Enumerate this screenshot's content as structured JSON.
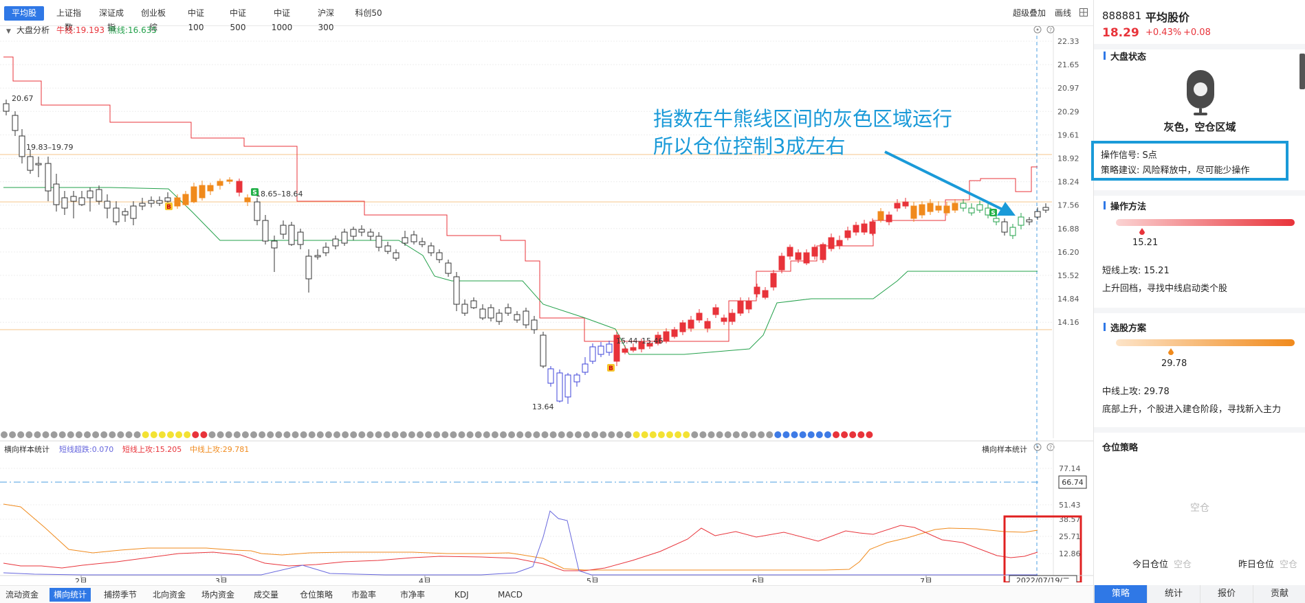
{
  "top_tabs": [
    "平均股价",
    "上证指数",
    "深证成指",
    "创业板综",
    "中证100",
    "中证500",
    "中证1000",
    "沪深300",
    "科创50"
  ],
  "active_top_tab": 0,
  "top_tools": {
    "overlay": "超级叠加",
    "draw": "画线"
  },
  "main_legend": {
    "toggle": "大盘分析",
    "bull_label": "牛线:19.193",
    "bear_label": "熊线:16.635"
  },
  "main_price_ticks": [
    "22.33",
    "21.65",
    "20.97",
    "20.29",
    "19.61",
    "18.92",
    "18.24",
    "17.56",
    "16.88",
    "16.20",
    "15.52",
    "14.84",
    "14.16"
  ],
  "main_annotations": {
    "a1": "20.67",
    "a2": "19.83–19.79",
    "a3": "18.65–18.64",
    "a4": "15.44–15.46",
    "a5": "13.64"
  },
  "callout": {
    "line1": "指数在牛熊线区间的灰色区域运行",
    "line2": "所以仓位控制3成左右"
  },
  "sub_legend": {
    "title": "横向样本统计",
    "short_drop": "短线超跌:0.070",
    "short_up": "短线上攻:15.205",
    "mid_up": "中线上攻:29.781",
    "right_title": "横向样本统计"
  },
  "sub_ticks": [
    "77.14",
    "51.43",
    "38.57",
    "25.71",
    "12.86"
  ],
  "sub_current_value": "66.74",
  "x_labels": [
    "2月",
    "3月",
    "4月",
    "5月",
    "6月",
    "7月"
  ],
  "x_current_date": "2022/07/19/二",
  "bottom_tabs": [
    "流动资金",
    "横向统计",
    "捕捞季节",
    "北向资金",
    "场内资金",
    "成交量",
    "仓位策略",
    "市盈率",
    "市净率",
    "KDJ",
    "MACD"
  ],
  "active_bottom_tab": 1,
  "panel": {
    "code": "888881",
    "name": "平均股价",
    "price": "18.29",
    "change_pct": "+0.43%",
    "change": "+0.08",
    "market_state_title": "大盘状态",
    "market_state_text": "灰色，空仓区域",
    "signal": "操作信号: S点",
    "advice": "策略建议: 风险释放中，尽可能少操作",
    "method_title": "操作方法",
    "method_value": "15.21",
    "method_line1": "短线上攻: 15.21",
    "method_line2": "上升回档，寻找中线启动类个股",
    "select_title": "选股方案",
    "select_value": "29.78",
    "select_line1": "中线上攻: 29.78",
    "select_line2": "底部上升，个股进入建仓阶段，寻找新入主力",
    "position_title": "仓位策略",
    "position_empty": "空仓",
    "today_label": "今日仓位",
    "today_value": "空仓",
    "yesterday_label": "昨日仓位",
    "yesterday_value": "空仓",
    "tabs": [
      "策略",
      "统计",
      "报价",
      "贡献"
    ],
    "active_tab": 0
  },
  "colors": {
    "accent": "#2f78e6",
    "up": "#e8333a",
    "down": "#22a04a",
    "bull_line": "#e8333a",
    "bear_line": "#22a04a",
    "orange": "#f08a1c",
    "blue_candle": "#3e43d8",
    "callout": "#1a9ad8"
  }
}
